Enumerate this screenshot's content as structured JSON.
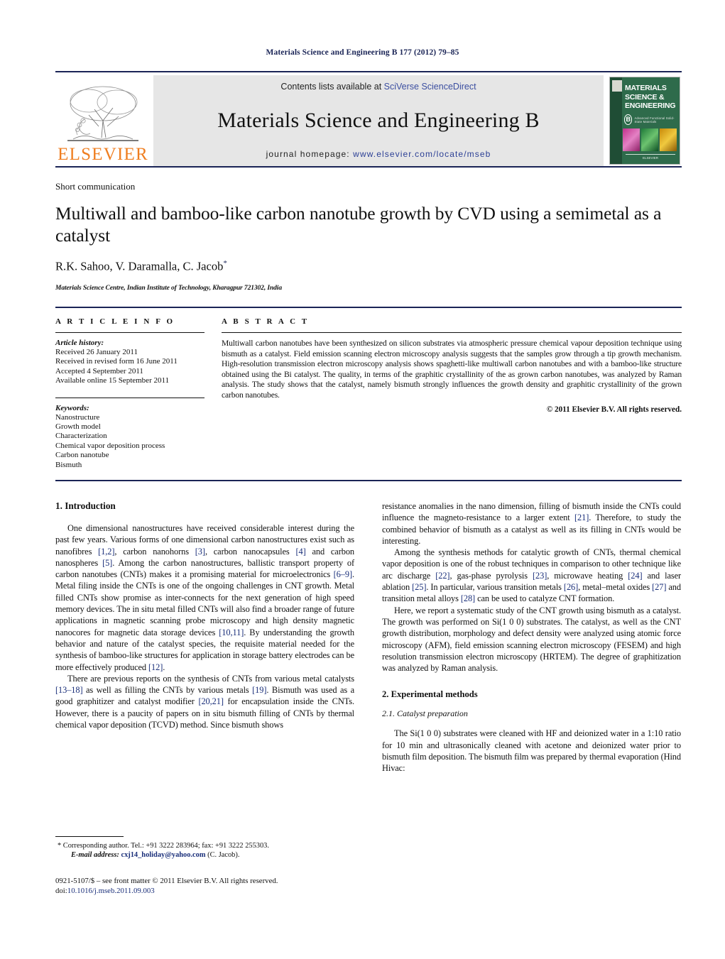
{
  "running_head": "Materials Science and Engineering B 177 (2012) 79–85",
  "masthead": {
    "publisher_name": "ELSEVIER",
    "contents_prefix": "Contents lists available at ",
    "contents_link": "SciVerse ScienceDirect",
    "journal_title": "Materials Science and Engineering B",
    "homepage_prefix": "journal homepage: ",
    "homepage_url": "www.elsevier.com/locate/mseb",
    "cover": {
      "title_line1": "MATERIALS",
      "title_line2": "SCIENCE &",
      "title_line3": "ENGINEERING",
      "series_letter": "B",
      "subtitle": "Advanced Functional Solid-State Materials",
      "footer": "ELSEVIER"
    }
  },
  "article": {
    "doctype": "Short communication",
    "title": "Multiwall and bamboo-like carbon nanotube growth by CVD using a semimetal as a catalyst",
    "authors": "R.K. Sahoo, V. Daramalla, C. Jacob",
    "corresponding_marker": "*",
    "affiliation": "Materials Science Centre, Indian Institute of Technology, Kharagpur 721302, India"
  },
  "article_info": {
    "heading": "A R T I C L E   I N F O",
    "history_label": "Article history:",
    "history": [
      "Received 26 January 2011",
      "Received in revised form 16 June 2011",
      "Accepted 4 September 2011",
      "Available online 15 September 2011"
    ],
    "keywords_label": "Keywords:",
    "keywords": [
      "Nanostructure",
      "Growth model",
      "Characterization",
      "Chemical vapor deposition process",
      "Carbon nanotube",
      "Bismuth"
    ]
  },
  "abstract": {
    "heading": "A B S T R A C T",
    "text": "Multiwall carbon nanotubes have been synthesized on silicon substrates via atmospheric pressure chemical vapour deposition technique using bismuth as a catalyst. Field emission scanning electron microscopy analysis suggests that the samples grow through a tip growth mechanism. High-resolution transmission electron microscopy analysis shows spaghetti-like multiwall carbon nanotubes and with a bamboo-like structure obtained using the Bi catalyst. The quality, in terms of the graphitic crystallinity of the as grown carbon nanotubes, was analyzed by Raman analysis. The study shows that the catalyst, namely bismuth strongly influences the growth density and graphitic crystallinity of the grown carbon nanotubes.",
    "copyright": "© 2011 Elsevier B.V. All rights reserved."
  },
  "sections": {
    "intro_heading": "1.  Introduction",
    "intro_p1_a": "One dimensional nanostructures have received considerable interest during the past few years. Various forms of one dimensional carbon nanostructures exist such as nanofibres ",
    "intro_p1_r1": "[1,2]",
    "intro_p1_b": ", carbon nanohorns ",
    "intro_p1_r2": "[3]",
    "intro_p1_c": ", carbon nanocapsules ",
    "intro_p1_r3": "[4]",
    "intro_p1_d": " and carbon nanospheres ",
    "intro_p1_r4": "[5]",
    "intro_p1_e": ". Among the carbon nanostructures, ballistic transport property of carbon nanotubes (CNTs) makes it a promising material for microelectronics ",
    "intro_p1_r5": "[6–9]",
    "intro_p1_f": ". Metal filing inside the CNTs is one of the ongoing challenges in CNT growth. Metal filled CNTs show promise as inter-connects for the next generation of high speed memory devices. The in situ metal filled CNTs will also find a broader range of future applications in magnetic scanning probe microscopy and high density magnetic nanocores for magnetic data storage devices ",
    "intro_p1_r6": "[10,11]",
    "intro_p1_g": ". By understanding the growth behavior and nature of the catalyst species, the requisite material needed for the synthesis of bamboo-like structures for application in storage battery electrodes can be more effectively produced ",
    "intro_p1_r7": "[12]",
    "intro_p1_h": ".",
    "intro_p2_a": "There are previous reports on the synthesis of CNTs from various metal catalysts ",
    "intro_p2_r1": "[13–18]",
    "intro_p2_b": " as well as filling the CNTs by various metals ",
    "intro_p2_r2": "[19]",
    "intro_p2_c": ". Bismuth was used as a good graphitizer and catalyst modifier ",
    "intro_p2_r3": "[20,21]",
    "intro_p2_d": " for encapsulation inside the CNTs. However, there is a paucity of papers on in situ bismuth filling of CNTs by thermal chemical vapor deposition (TCVD) method. Since bismuth shows",
    "intro_p3_a": "resistance anomalies in the nano dimension, filling of bismuth inside the CNTs could influence the magneto-resistance to a larger extent ",
    "intro_p3_r1": "[21]",
    "intro_p3_b": ". Therefore, to study the combined behavior of bismuth as a catalyst as well as its filling in CNTs would be interesting.",
    "intro_p4_a": "Among the synthesis methods for catalytic growth of CNTs, thermal chemical vapor deposition is one of the robust techniques in comparison to other technique like arc discharge ",
    "intro_p4_r1": "[22]",
    "intro_p4_b": ", gas-phase pyrolysis ",
    "intro_p4_r2": "[23]",
    "intro_p4_c": ", microwave heating ",
    "intro_p4_r3": "[24]",
    "intro_p4_d": " and laser ablation ",
    "intro_p4_r4": "[25]",
    "intro_p4_e": ". In particular, various transition metals ",
    "intro_p4_r5": "[26]",
    "intro_p4_f": ", metal–metal oxides ",
    "intro_p4_r6": "[27]",
    "intro_p4_g": " and transition metal alloys ",
    "intro_p4_r7": "[28]",
    "intro_p4_h": " can be used to catalyze CNT formation.",
    "intro_p5": "Here, we report a systematic study of the CNT growth using bismuth as a catalyst. The growth was performed on Si(1 0 0) substrates. The catalyst, as well as the CNT growth distribution, morphology and defect density were analyzed using atomic force microscopy (AFM), field emission scanning electron microscopy (FESEM) and high resolution transmission electron microscopy (HRTEM). The degree of graphitization was analyzed by Raman analysis.",
    "exp_heading": "2.  Experimental methods",
    "exp_sub_heading": "2.1.  Catalyst preparation",
    "exp_p1": "The Si(1 0 0) substrates were cleaned with HF and deionized water in a 1:10 ratio for 10 min and ultrasonically cleaned with acetone and deionized water prior to bismuth film deposition. The bismuth film was prepared by thermal evaporation (Hind Hivac:"
  },
  "footnotes": {
    "corresponding": "* Corresponding author. Tel.: +91 3222 283964; fax: +91 3222 255303.",
    "email_label": "E-mail address:",
    "email": "cxj14_holiday@yahoo.com",
    "email_suffix": " (C. Jacob).",
    "issn": "0921-5107/$ – see front matter © 2011 Elsevier B.V. All rights reserved.",
    "doi_label": "doi:",
    "doi": "10.1016/j.mseb.2011.09.003"
  }
}
